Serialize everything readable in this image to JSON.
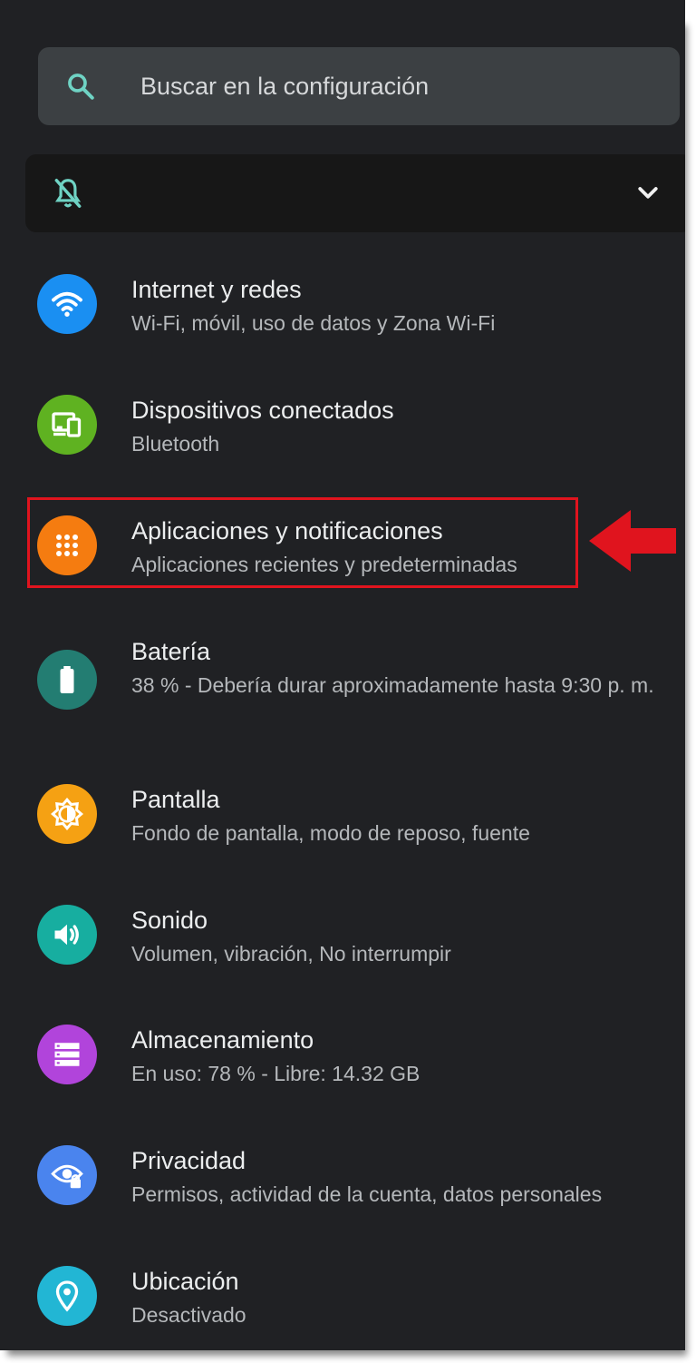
{
  "search": {
    "placeholder": "Buscar en la configuración"
  },
  "suggestion_bar": {
    "icon": "notifications-off-icon",
    "expand_icon": "chevron-down-icon"
  },
  "settings": [
    {
      "title": "Internet y redes",
      "subtitle": "Wi-Fi, móvil, uso de datos y Zona Wi-Fi",
      "icon": "wifi-icon",
      "color": "#1a8ff2"
    },
    {
      "title": "Dispositivos conectados",
      "subtitle": "Bluetooth",
      "icon": "devices-icon",
      "color": "#5fb221"
    },
    {
      "title": "Aplicaciones y notificaciones",
      "subtitle": "Aplicaciones recientes y predeterminadas",
      "icon": "apps-icon",
      "color": "#f57c10"
    },
    {
      "title": "Batería",
      "subtitle": "38 % - Debería durar aproximadamente hasta 9:30 p. m.",
      "icon": "battery-icon",
      "color": "#237d72"
    },
    {
      "title": "Pantalla",
      "subtitle": "Fondo de pantalla, modo de reposo, fuente",
      "icon": "brightness-icon",
      "color": "#f5a113"
    },
    {
      "title": "Sonido",
      "subtitle": "Volumen, vibración, No interrumpir",
      "icon": "volume-icon",
      "color": "#17aea0"
    },
    {
      "title": "Almacenamiento",
      "subtitle": "En uso: 78 % - Libre: 14.32 GB",
      "icon": "storage-icon",
      "color": "#b144db"
    },
    {
      "title": "Privacidad",
      "subtitle": "Permisos, actividad de la cuenta, datos personales",
      "icon": "privacy-eye-icon",
      "color": "#4a84ee"
    },
    {
      "title": "Ubicación",
      "subtitle": "Desactivado",
      "icon": "location-pin-icon",
      "color": "#22b6d4"
    }
  ],
  "annotation": {
    "highlight_color": "#e0141e"
  }
}
